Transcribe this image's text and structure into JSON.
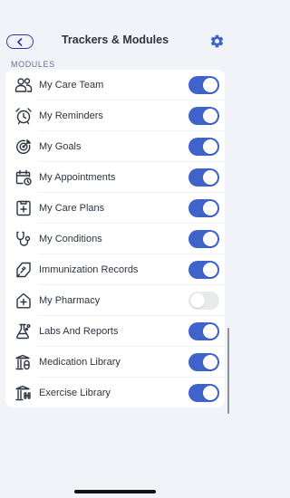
{
  "header": {
    "title": "Trackers & Modules",
    "back_icon": "chevron-left-icon",
    "settings_icon": "gear-icon"
  },
  "section": {
    "label": "MODULES"
  },
  "modules": [
    {
      "label": "My Care Team",
      "icon": "care-team-icon",
      "enabled": true
    },
    {
      "label": "My Reminders",
      "icon": "alarm-clock-icon",
      "enabled": true
    },
    {
      "label": "My Goals",
      "icon": "target-icon",
      "enabled": true
    },
    {
      "label": "My Appointments",
      "icon": "calendar-clock-icon",
      "enabled": true
    },
    {
      "label": "My Care Plans",
      "icon": "folder-plus-icon",
      "enabled": true
    },
    {
      "label": "My Conditions",
      "icon": "stethoscope-icon",
      "enabled": true
    },
    {
      "label": "Immunization Records",
      "icon": "syringe-icon",
      "enabled": true
    },
    {
      "label": "My Pharmacy",
      "icon": "pharmacy-house-icon",
      "enabled": false
    },
    {
      "label": "Labs And Reports",
      "icon": "flask-icon",
      "enabled": true
    },
    {
      "label": "Medication Library",
      "icon": "library-pill-icon",
      "enabled": true
    },
    {
      "label": "Exercise Library",
      "icon": "library-dumbbell-icon",
      "enabled": true
    }
  ],
  "colors": {
    "accent": "#3f63c9",
    "back_button": "#2f3a9a",
    "background": "#f1f3f8",
    "toggle_off": "#e9eaec"
  }
}
